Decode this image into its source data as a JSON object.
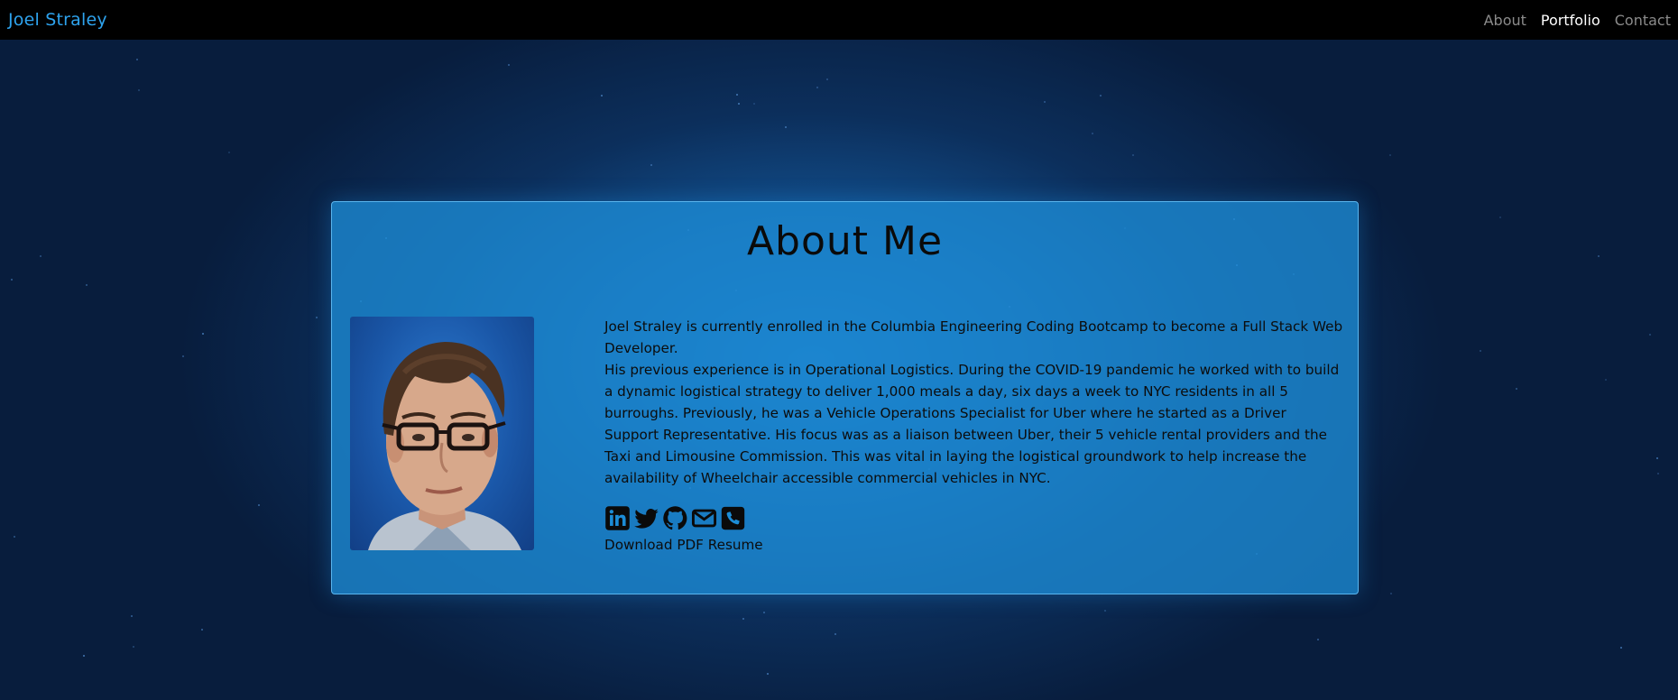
{
  "navbar": {
    "brand": "Joel Straley",
    "links": [
      {
        "label": "About"
      },
      {
        "label": "Portfolio"
      },
      {
        "label": "Contact"
      }
    ]
  },
  "about": {
    "title": "About Me",
    "photo_icon": "portrait-photo",
    "paragraphs": [
      "Joel Straley is currently enrolled in the Columbia Engineering Coding Bootcamp to become a Full Stack Web Developer.",
      "His previous experience is in Operational Logistics. During the COVID-19 pandemic he worked with to build a dynamic logistical strategy to deliver 1,000 meals a day, six days a week to NYC residents in all 5 burroughs. Previously, he was a Vehicle Operations Specialist for Uber where he started as a Driver Support Representative. His focus was as a liaison between Uber, their 5 vehicle rental providers and the Taxi and Limousine Commission. This was vital in laying the logistical groundwork to help increase the availability of Wheelchair accessible commercial vehicles in NYC."
    ],
    "social_icons": [
      "linkedin-icon",
      "twitter-icon",
      "github-icon",
      "email-icon",
      "phone-icon"
    ],
    "resume_link": "Download PDF Resume"
  },
  "colors": {
    "brand": "#2ea3ee",
    "card_bg": "#1c8cd6",
    "navbar_bg": "#000000"
  }
}
